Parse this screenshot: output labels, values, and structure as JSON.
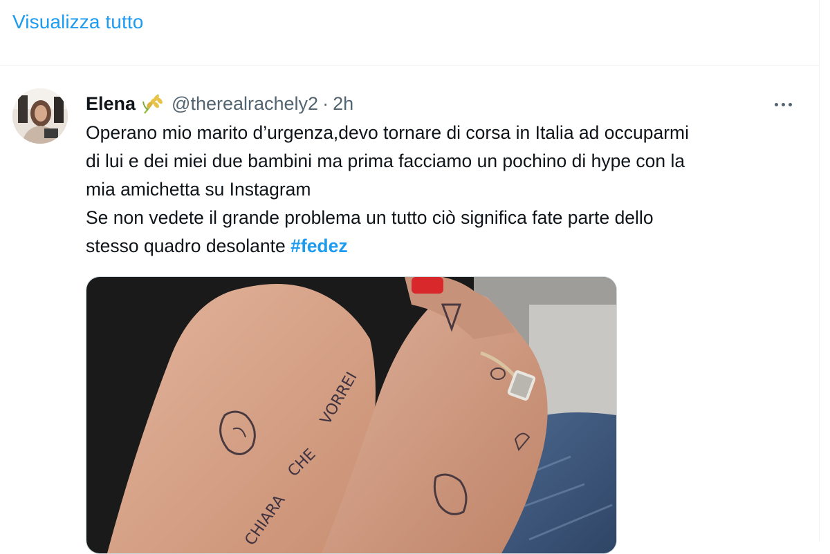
{
  "top": {
    "show_all_label": "Visualizza tutto"
  },
  "tweet": {
    "author_name": "Elena",
    "author_emoji": "rice-plant-emoji",
    "handle": "@therealrachely2",
    "separator": "·",
    "time": "2h",
    "more_icon": "ellipsis-icon",
    "text_lines": [
      "Operano mio marito d’urgenza,devo tornare di corsa in Italia ad occuparmi",
      "di lui e dei miei due bambini ma prima facciamo un pochino di hype con la",
      "mia amichetta su Instagram",
      "Se non vedete il grande problema un tutto ciò significa fate parte dello",
      "stesso quadro desolante "
    ],
    "hashtag": "#fedez",
    "media": {
      "description_icon": "photo-of-tattooed-hands",
      "tattoo_text_1": "VORREI",
      "tattoo_text_2": "CHE",
      "tattoo_text_3": "CHIARA"
    }
  },
  "colors": {
    "link": "#1d9bf0",
    "text": "#0f1419",
    "secondary": "#536471",
    "border": "#eff3f4"
  }
}
